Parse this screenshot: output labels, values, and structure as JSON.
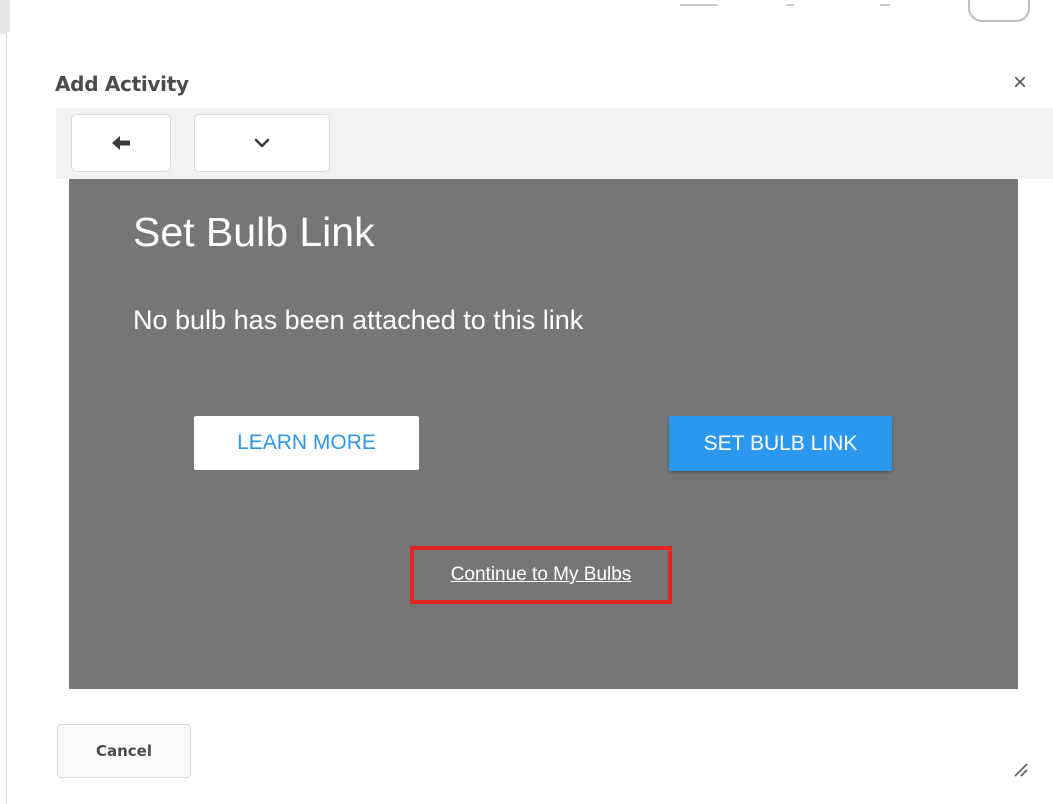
{
  "dialog": {
    "title": "Add Activity",
    "close_icon": "close-icon",
    "close_glyph": "×"
  },
  "toolbar": {
    "back_icon": "arrow-left-icon",
    "menu_icon": "chevron-down-icon"
  },
  "bulb_panel": {
    "title": "Set Bulb Link",
    "message": "No bulb has been attached to this link",
    "learn_more_label": "LEARN MORE",
    "set_link_label": "SET BULB LINK",
    "continue_link_label": "Continue to My Bulbs",
    "highlight_color": "#e0261f",
    "accent_color": "#2c97ef",
    "background_color": "#767676"
  },
  "footer": {
    "cancel_label": "Cancel",
    "resize_icon": "resize-handle-icon"
  }
}
